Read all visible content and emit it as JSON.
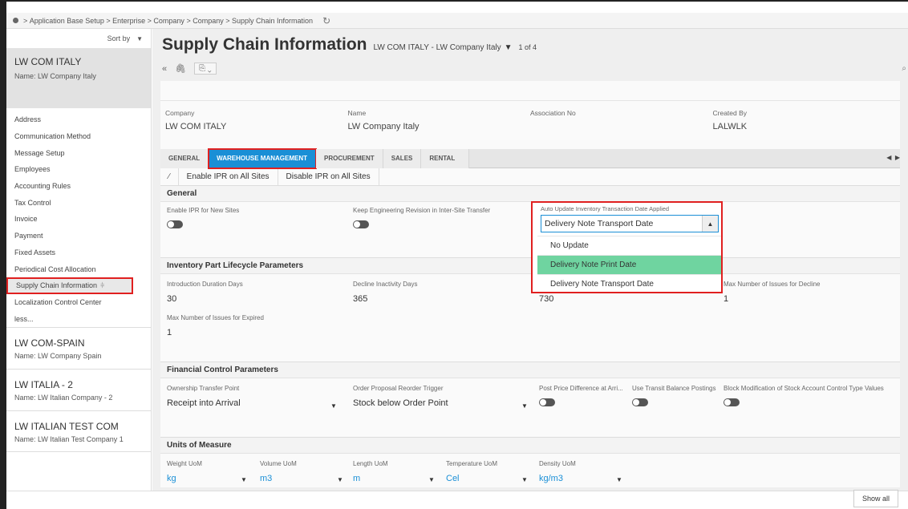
{
  "breadcrumb": {
    "items": [
      "Application Base Setup",
      "Enterprise",
      "Company",
      "Company",
      "Supply Chain Information"
    ],
    "separator": " > "
  },
  "sidebar": {
    "sort_label": "Sort by",
    "selected_record": {
      "title": "LW COM ITALY",
      "subtitle": "Name:  LW Company Italy"
    },
    "items": [
      "Address",
      "Communication Method",
      "Message Setup",
      "Employees",
      "Accounting Rules",
      "Tax Control",
      "Invoice",
      "Payment",
      "Fixed Assets",
      "Periodical Cost Allocation",
      "Supply Chain Information",
      "Localization Control Center",
      "less..."
    ],
    "other_records": [
      {
        "title": "LW COM-SPAIN",
        "subtitle": "Name:  LW Company Spain"
      },
      {
        "title": "LW ITALIA - 2",
        "subtitle": "Name:  LW Italian Company - 2"
      },
      {
        "title": "LW ITALIAN TEST COM",
        "subtitle": "Name:  LW Italian Test Company 1"
      }
    ]
  },
  "header": {
    "title": "Supply Chain Information",
    "record": "LW COM ITALY - LW Company Italy",
    "count": "1 of 4"
  },
  "header_fields": [
    {
      "label": "Company",
      "value": "LW COM ITALY"
    },
    {
      "label": "Name",
      "value": "LW Company Italy"
    },
    {
      "label": "Association No",
      "value": ""
    },
    {
      "label": "Created By",
      "value": "LALWLK"
    }
  ],
  "tabs": [
    "GENERAL",
    "WAREHOUSE MANAGEMENT",
    "PROCUREMENT",
    "SALES",
    "RENTAL"
  ],
  "actions": [
    "Enable IPR on All Sites",
    "Disable IPR on All Sites"
  ],
  "general": {
    "heading": "General",
    "enable_ipr_label": "Enable IPR for New Sites",
    "keep_eng_label": "Keep Engineering Revision in Inter-Site Transfer"
  },
  "dropdown": {
    "label": "Auto Update Inventory Transaction Date Applied",
    "value": "Delivery Note Transport Date",
    "options": [
      "No Update",
      "Delivery Note Print Date",
      "Delivery Note Transport Date"
    ]
  },
  "lifecycle": {
    "heading": "Inventory Part Lifecycle Parameters",
    "intro_label": "Introduction Duration Days",
    "intro_value": "30",
    "decline_label": "Decline Inactivity Days",
    "decline_value": "365",
    "third_value": "730",
    "max_decline_label": "Max Number of Issues for Decline",
    "max_decline_value": "1",
    "max_expired_label": "Max Number of Issues for Expired",
    "max_expired_value": "1"
  },
  "financial": {
    "heading": "Financial Control Parameters",
    "owner_label": "Ownership Transfer Point",
    "owner_value": "Receipt into Arrival",
    "reorder_label": "Order Proposal Reorder Trigger",
    "reorder_value": "Stock below Order Point",
    "post_price_label": "Post Price Difference at Arri...",
    "transit_label": "Use Transit Balance Postings",
    "block_label": "Block Modification of Stock Account Control Type Values"
  },
  "uom": {
    "heading": "Units of Measure",
    "weight_label": "Weight UoM",
    "weight_value": "kg",
    "volume_label": "Volume UoM",
    "volume_value": "m3",
    "length_label": "Length UoM",
    "length_value": "m",
    "temp_label": "Temperature UoM",
    "temp_value": "Cel",
    "density_label": "Density UoM",
    "density_value": "kg/m3"
  },
  "footer": {
    "show_all": "Show all"
  },
  "colors": {
    "accent": "#1a8fd6",
    "highlight": "#6fd4a0",
    "annotation": "#e02020"
  }
}
